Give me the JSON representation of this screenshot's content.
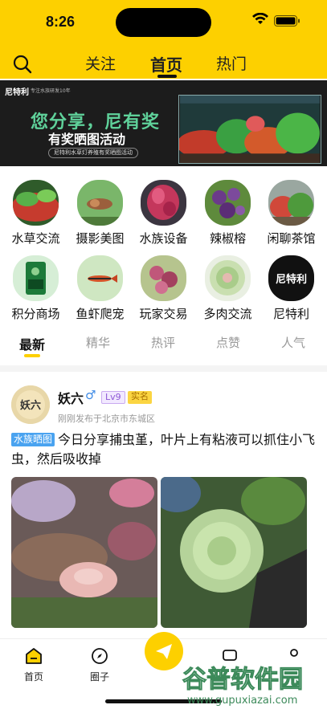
{
  "status": {
    "time": "8:26"
  },
  "nav": {
    "tabs": [
      "关注",
      "首页",
      "热门"
    ],
    "active": "首页"
  },
  "banner": {
    "brand": "尼特利",
    "sub": "专注水族研发10年",
    "title": "您分享，尼有奖",
    "title2": "有奖晒图活动",
    "pill": "尼特利水草灯养殖有奖晒图活动"
  },
  "categories": [
    {
      "label": "水草交流",
      "icon": "aquatic-plant-icon"
    },
    {
      "label": "摄影美图",
      "icon": "shrimp-photo-icon"
    },
    {
      "label": "水族设备",
      "icon": "red-plant-icon"
    },
    {
      "label": "辣椒榕",
      "icon": "purple-plant-icon"
    },
    {
      "label": "闲聊茶馆",
      "icon": "aquascape-icon"
    },
    {
      "label": "积分商场",
      "icon": "product-bag-icon"
    },
    {
      "label": "鱼虾爬宠",
      "icon": "fish-icon"
    },
    {
      "label": "玩家交易",
      "icon": "stem-plant-icon"
    },
    {
      "label": "多肉交流",
      "icon": "succulent-icon"
    },
    {
      "label": "尼特利",
      "icon": "brand-logo-icon",
      "brand_text": "尼特利"
    }
  ],
  "feed_tabs": [
    "最新",
    "精华",
    "热评",
    "点赞",
    "人气"
  ],
  "feed_active": "最新",
  "post": {
    "username": "妖六",
    "gender": "♂",
    "level": "Lv9",
    "verified": "实名",
    "meta": "刚刚发布于北京市东城区",
    "tag": "水族晒图",
    "text": "今日分享捕虫堇，叶片上有粘液可以抓住小飞虫，然后吸收掉",
    "avatar_text": "妖六"
  },
  "tabbar": {
    "items": [
      "首页",
      "圈子"
    ]
  },
  "watermark": {
    "text": "谷普软件园",
    "url": "www.gupuxiazai.com"
  },
  "colors": {
    "brand_yellow": "#fdd000",
    "tag_blue": "#4aa3f0",
    "level_purple": "#8e58d6"
  }
}
